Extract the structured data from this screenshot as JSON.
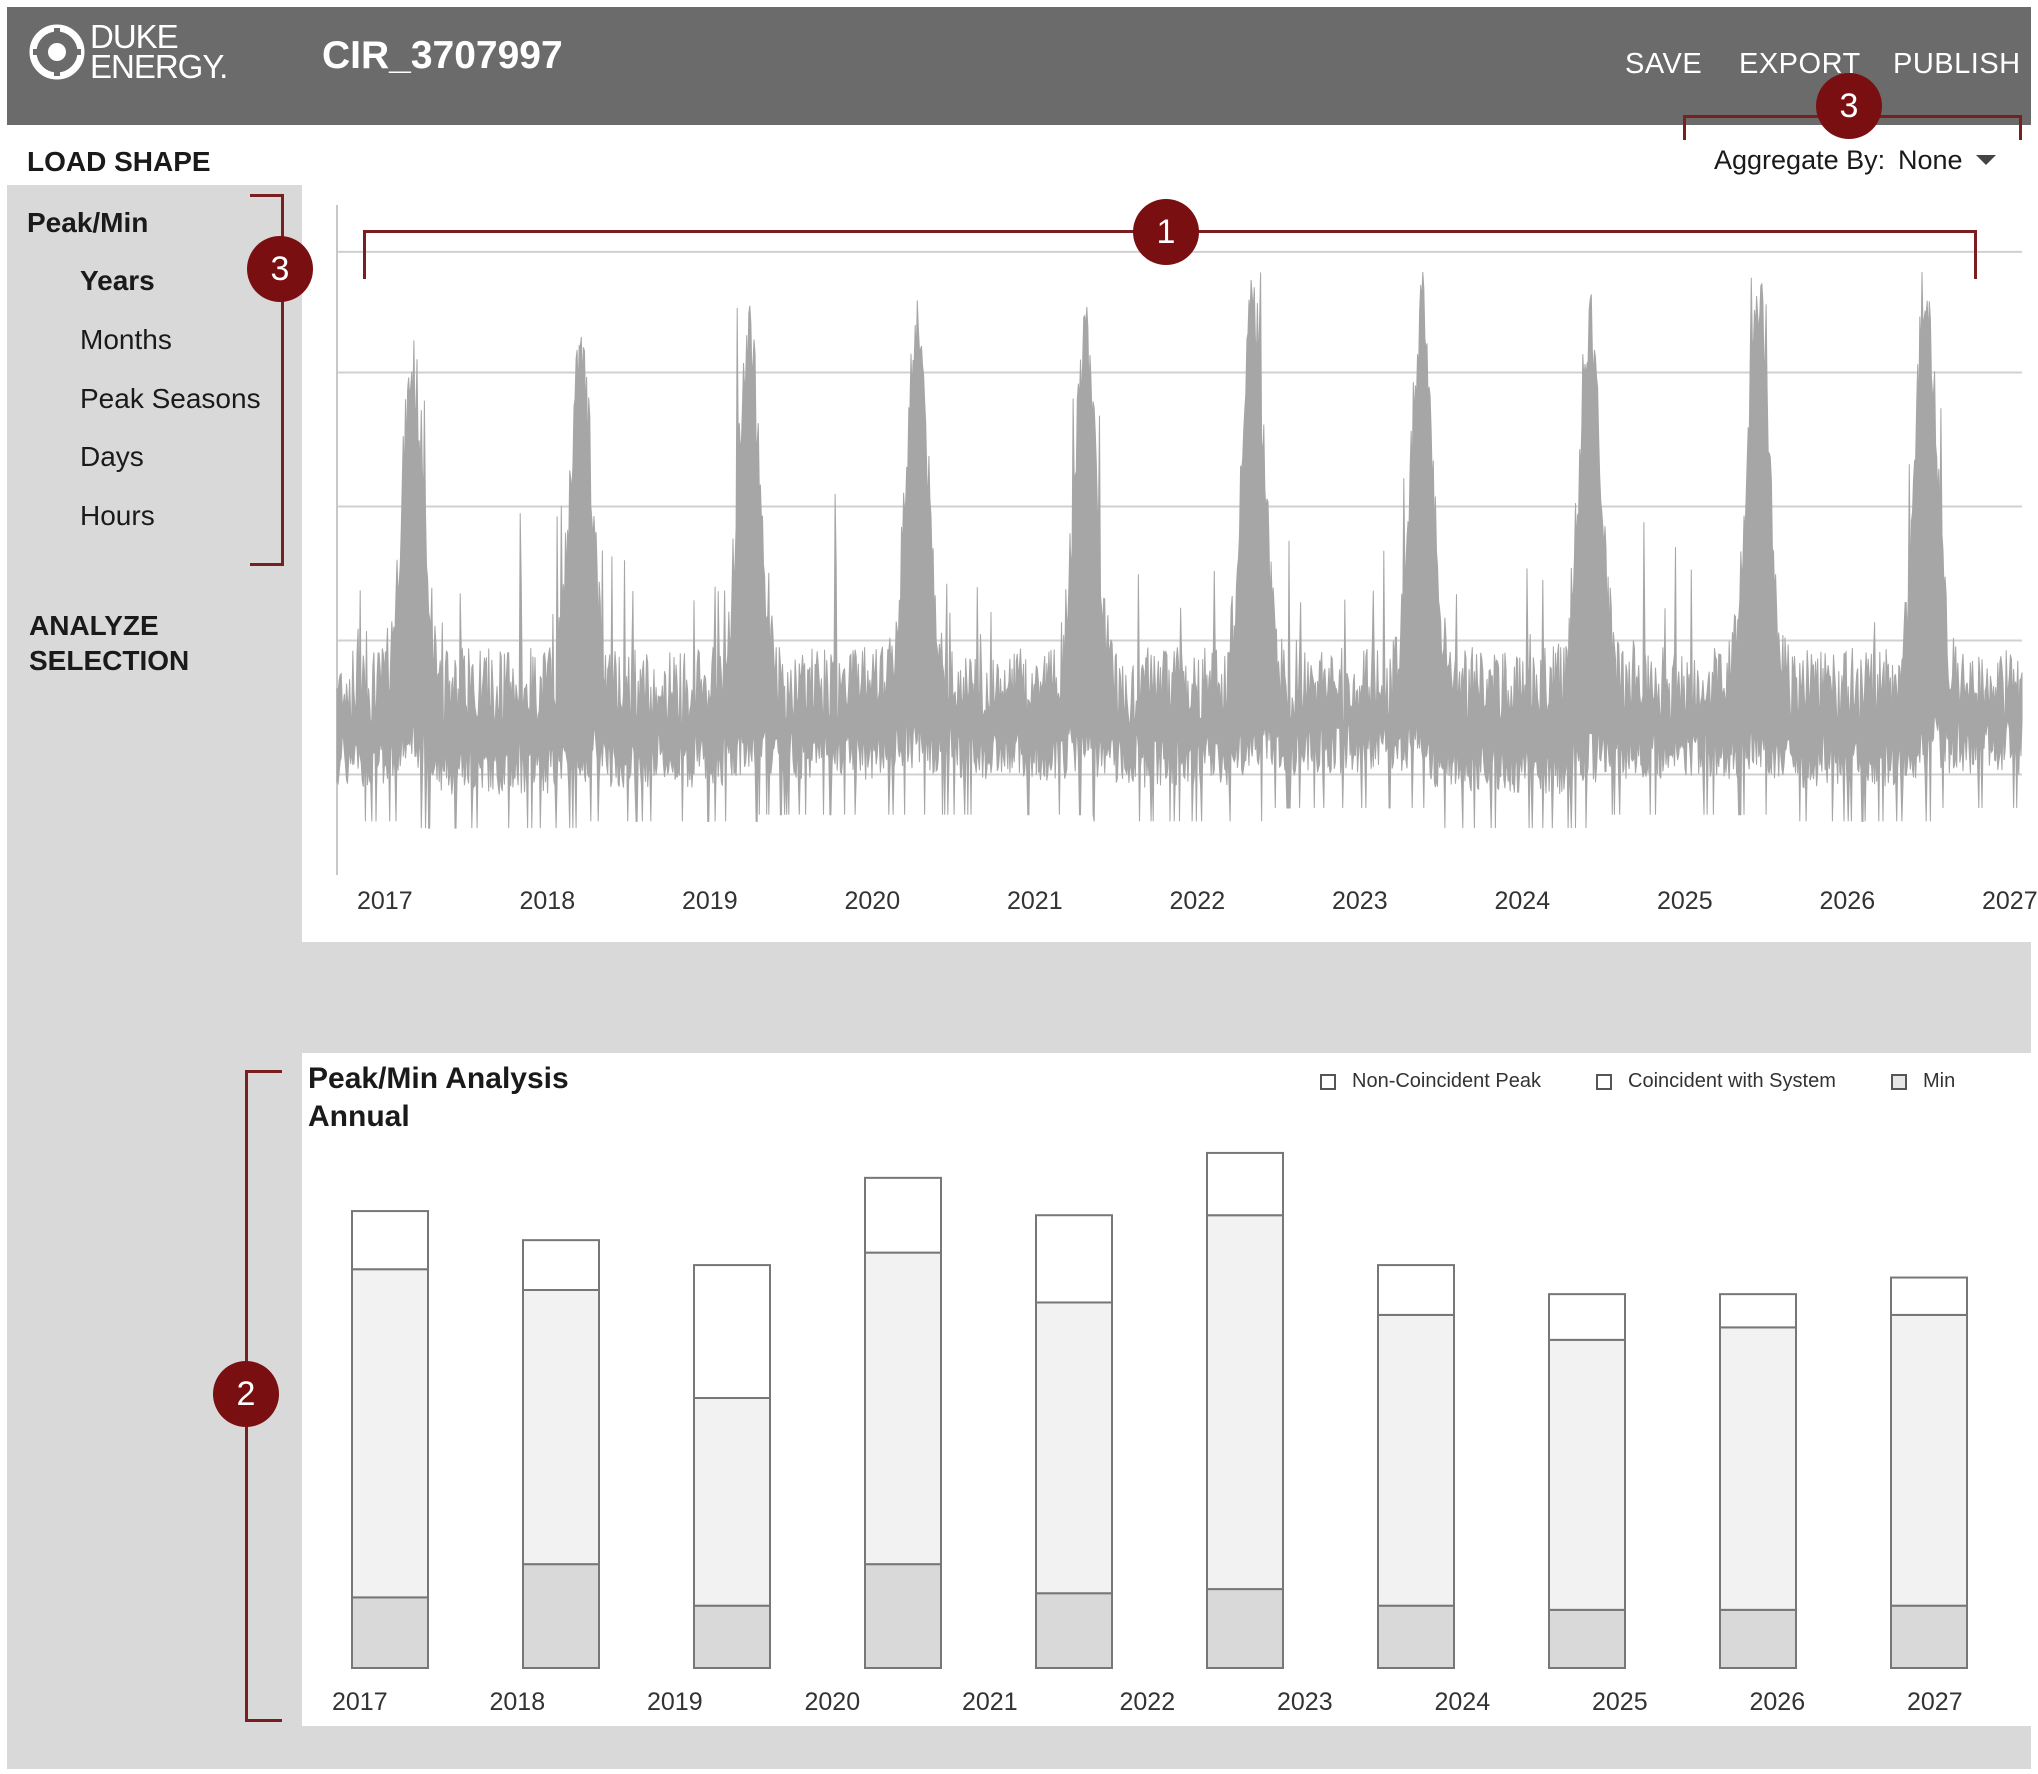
{
  "header": {
    "logo_line1": "DUKE",
    "logo_line2": "ENERGY.",
    "title": "CIR_3707997",
    "actions": [
      "SAVE",
      "EXPORT",
      "PUBLISH"
    ]
  },
  "load_shape": {
    "title": "LOAD SHAPE",
    "aggregate_label": "Aggregate By:",
    "aggregate_value": "None"
  },
  "sidebar": {
    "section": "Peak/Min",
    "items": [
      "Years",
      "Months",
      "Peak Seasons",
      "Days",
      "Hours"
    ],
    "analyze_line1": "ANALYZE",
    "analyze_line2": "SELECTION"
  },
  "annotations": [
    "1",
    "2",
    "3",
    "3"
  ],
  "colors": {
    "accent": "#7a0f12",
    "header": "#6b6b6b",
    "series": "#a6a6a6",
    "panel": "#d9d9d9"
  },
  "chart_data": [
    {
      "type": "area",
      "title": "",
      "xlabel": "",
      "ylabel": "",
      "x_ticks": [
        "2017",
        "2018",
        "2019",
        "2020",
        "2021",
        "2022",
        "2023",
        "2024",
        "2025",
        "2026",
        "2027"
      ],
      "grid": true,
      "legend": "none",
      "series": [
        {
          "peak_relative": [
            0.75,
            0.77,
            0.8,
            0.82,
            0.8,
            0.85,
            0.83,
            0.83,
            0.87,
            0.87,
            0.82
          ],
          "trough_relative": [
            0.08,
            0.07,
            0.08,
            0.09,
            0.09,
            0.08,
            0.1,
            0.07,
            0.09,
            0.08,
            0.1
          ]
        }
      ]
    },
    {
      "type": "bar",
      "stacked": true,
      "title": "Peak/Min Analysis",
      "subtitle": "Annual",
      "categories": [
        "2017",
        "2018",
        "2019",
        "2020",
        "2021",
        "2022",
        "2023",
        "2024",
        "2025",
        "2026",
        "2027"
      ],
      "legend": "top-right",
      "series": [
        {
          "name": "Min",
          "values": [
            17,
            25,
            15,
            25,
            18,
            19,
            15,
            14,
            14,
            15,
            17
          ]
        },
        {
          "name": "Coincident with System",
          "values": [
            79,
            66,
            50,
            75,
            70,
            90,
            70,
            65,
            68,
            70,
            79
          ]
        },
        {
          "name": "Non-Coincident Peak",
          "values": [
            14,
            12,
            32,
            18,
            21,
            15,
            12,
            11,
            8,
            9,
            14
          ]
        }
      ],
      "ylim": [
        0,
        130
      ]
    }
  ]
}
